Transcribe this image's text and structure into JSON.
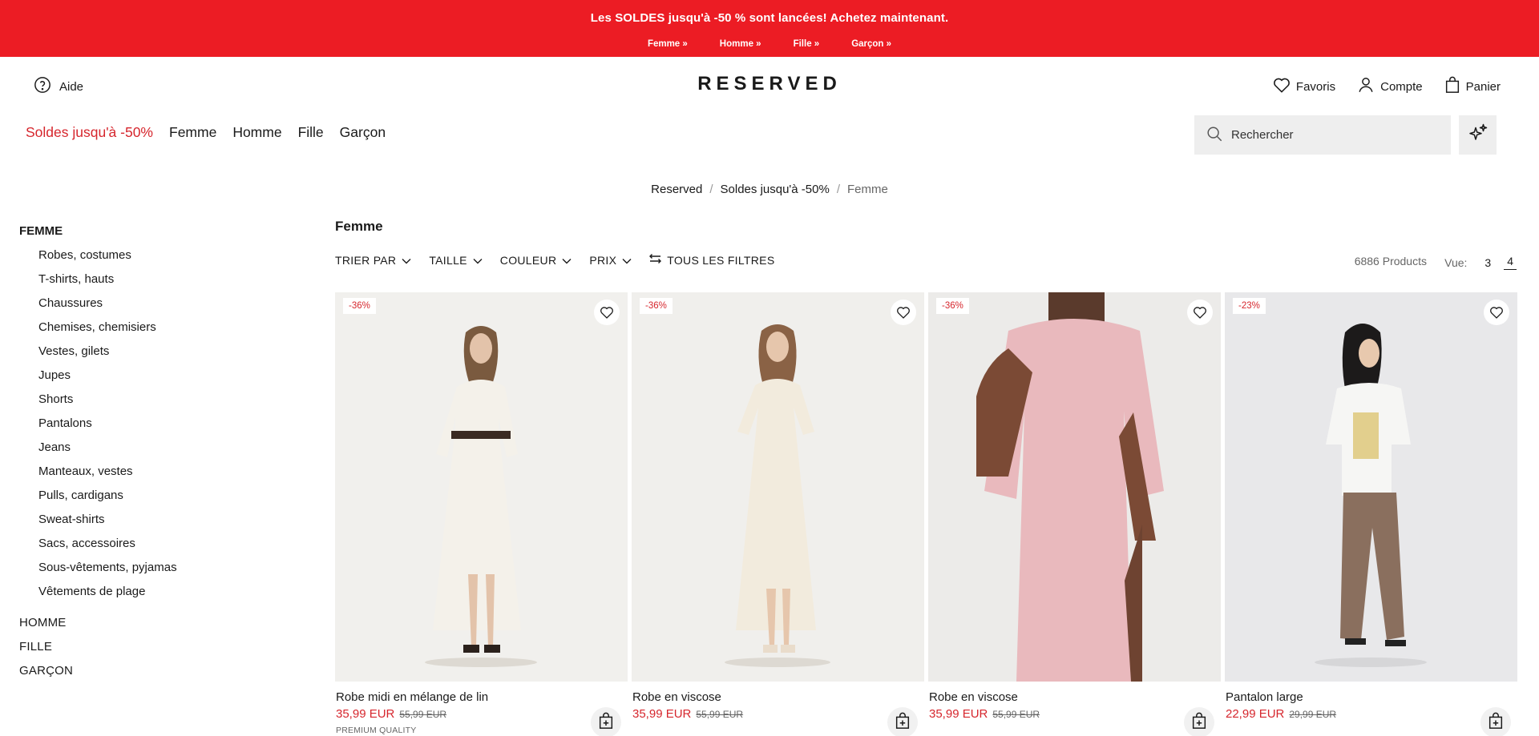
{
  "promo": {
    "title": "Les SOLDES jusqu'à -50 % sont lancées! Achetez maintenant.",
    "links": [
      "Femme »",
      "Homme »",
      "Fille »",
      "Garçon »"
    ]
  },
  "header": {
    "help_label": "Aide",
    "logo": "RESERVED",
    "favorites_label": "Favoris",
    "account_label": "Compte",
    "cart_label": "Panier"
  },
  "nav": {
    "items": [
      "Soldes jusqu'à -50%",
      "Femme",
      "Homme",
      "Fille",
      "Garçon"
    ],
    "sale_color": "#d6262d"
  },
  "search": {
    "placeholder": "Rechercher"
  },
  "breadcrumb": [
    "Reserved",
    "Soldes jusqu'à -50%",
    "Femme"
  ],
  "sidebar": {
    "heading": "FEMME",
    "subcategories": [
      "Robes, costumes",
      "T-shirts, hauts",
      "Chaussures",
      "Chemises, chemisiers",
      "Vestes, gilets",
      "Jupes",
      "Shorts",
      "Pantalons",
      "Jeans",
      "Manteaux, vestes",
      "Pulls, cardigans",
      "Sweat-shirts",
      "Sacs, accessoires",
      "Sous-vêtements, pyjamas",
      "Vêtements de plage"
    ],
    "categories": [
      "HOMME",
      "FILLE",
      "GARÇON"
    ]
  },
  "listing": {
    "title": "Femme",
    "filters": [
      "TRIER PAR",
      "TAILLE",
      "COULEUR",
      "PRIX"
    ],
    "all_filters": "TOUS LES FILTRES",
    "count": "6886 Products",
    "view_label": "Vue:",
    "view_options": [
      "3",
      "4"
    ],
    "active_view": "4"
  },
  "products": [
    {
      "name": "Robe midi en mélange de lin",
      "price": "35,99 EUR",
      "old_price": "55,99 EUR",
      "discount": "-36%",
      "tag": "PREMIUM QUALITY",
      "bg": "#f1f0ed",
      "garment": "#f4f1ea"
    },
    {
      "name": "Robe en viscose",
      "price": "35,99 EUR",
      "old_price": "55,99 EUR",
      "discount": "-36%",
      "tag": "",
      "bg": "#f0efec",
      "garment": "#f2ebdd"
    },
    {
      "name": "Robe en viscose",
      "price": "35,99 EUR",
      "old_price": "55,99 EUR",
      "discount": "-36%",
      "tag": "",
      "bg": "#ecebe9",
      "garment": "#e9b9bd"
    },
    {
      "name": "Pantalon large",
      "price": "22,99 EUR",
      "old_price": "29,99 EUR",
      "discount": "-23%",
      "tag": "",
      "bg": "#e8e8ea",
      "garment": "#8a6f5e"
    }
  ],
  "icons": {
    "help": "question-circle-icon",
    "favorites": "heart-icon",
    "account": "user-icon",
    "cart": "shopping-bag-icon",
    "search": "search-icon",
    "ai": "sparkles-icon",
    "filters": "sliders-icon",
    "add_to_cart": "bag-plus-icon"
  }
}
